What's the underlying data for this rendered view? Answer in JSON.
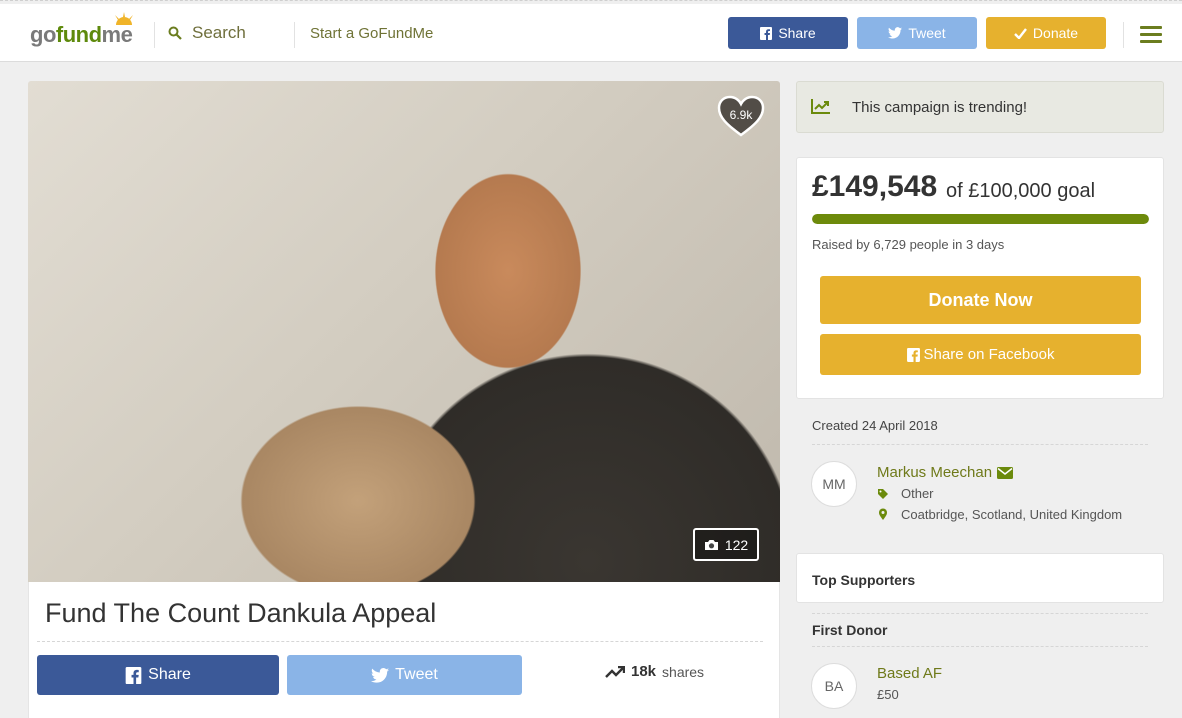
{
  "header": {
    "logo_go": "go",
    "logo_fund": "fund",
    "logo_me": "me",
    "search_label": "Search",
    "start_label": "Start a GoFundMe",
    "share_label": "Share",
    "tweet_label": "Tweet",
    "donate_label": "Donate"
  },
  "campaign": {
    "title": "Fund The Count Dankula Appeal",
    "hearts": "6.9k",
    "photo_count": "122",
    "share_label": "Share",
    "tweet_label": "Tweet",
    "shares_count": "18k",
    "shares_label": "shares"
  },
  "sidebar": {
    "trending": "This campaign is trending!",
    "raised": "£149,548",
    "goal": "of £100,000 goal",
    "progress_fraction": 1.0,
    "raised_by": "Raised by 6,729 people in 3 days",
    "donate_now": "Donate Now",
    "share_facebook": "Share on Facebook",
    "created": "Created 24 April 2018",
    "organizer": {
      "initials": "MM",
      "name": "Markus Meechan",
      "category": "Other",
      "location": "Coatbridge, Scotland, United Kingdom"
    },
    "top_supporters": "Top Supporters",
    "first_donor_heading": "First Donor",
    "first_donor": {
      "initials": "BA",
      "name": "Based AF",
      "amount": "£50"
    }
  },
  "colors": {
    "facebook": "#3b5998",
    "twitter": "#8ab4e7",
    "donate": "#e6b12e",
    "progress": "#6d8a0b",
    "accent_green": "#6f7a1a"
  }
}
